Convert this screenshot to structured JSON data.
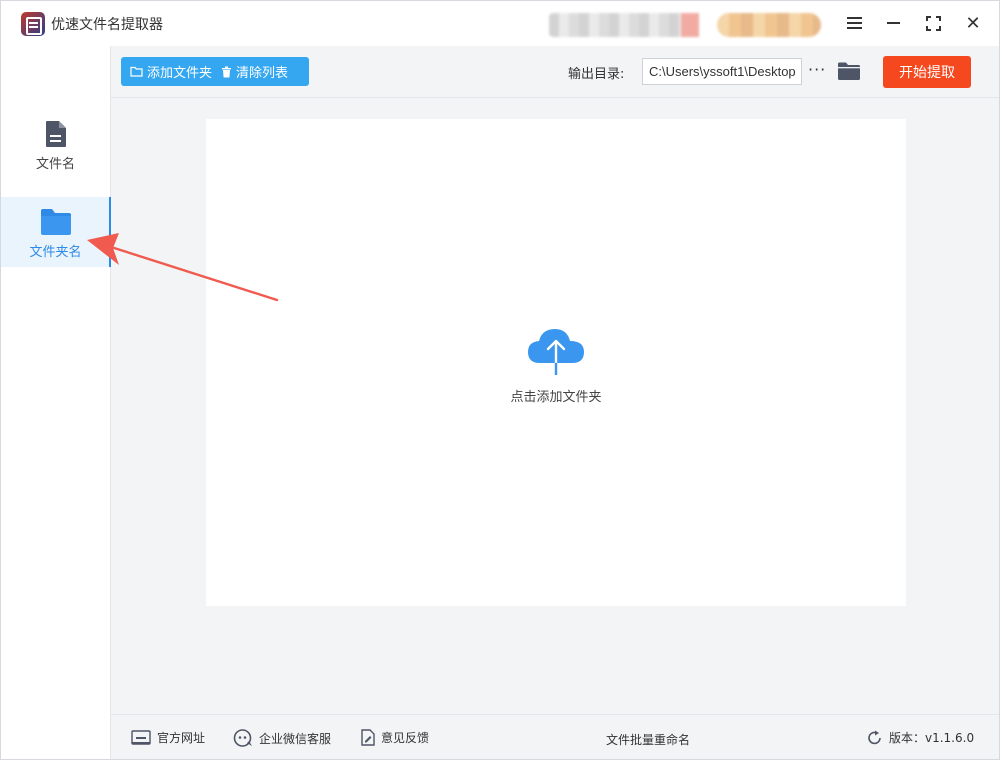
{
  "app": {
    "title": "优速文件名提取器"
  },
  "titlebar_icons": [
    "menu-icon",
    "minimize-icon",
    "maximize-icon",
    "close-icon"
  ],
  "close_glyph": "✕",
  "sidebar": {
    "items": [
      {
        "label": "文件名",
        "icon": "file-icon",
        "active": false
      },
      {
        "label": "文件夹名",
        "icon": "folder-icon",
        "active": true
      }
    ]
  },
  "toolbar": {
    "add_folder_label": "添加文件夹",
    "clear_list_label": "清除列表",
    "output_dir_label": "输出目录:",
    "output_dir_value": "C:\\Users\\yssoft1\\Desktop",
    "more_label": "···",
    "start_label": "开始提取"
  },
  "drop_area": {
    "text": "点击添加文件夹",
    "icon": "cloud-upload-icon"
  },
  "statusbar": {
    "website_label": "官方网址",
    "wechat_label": "企业微信客服",
    "feedback_label": "意见反馈",
    "center_label": "文件批量重命名",
    "version_label": "版本：v1.1.6.0"
  },
  "colors": {
    "accent": "#2e8ae6",
    "toolbar_button": "#35a7f0",
    "start_button": "#f5481f",
    "annotation_arrow": "#f05a4f"
  }
}
